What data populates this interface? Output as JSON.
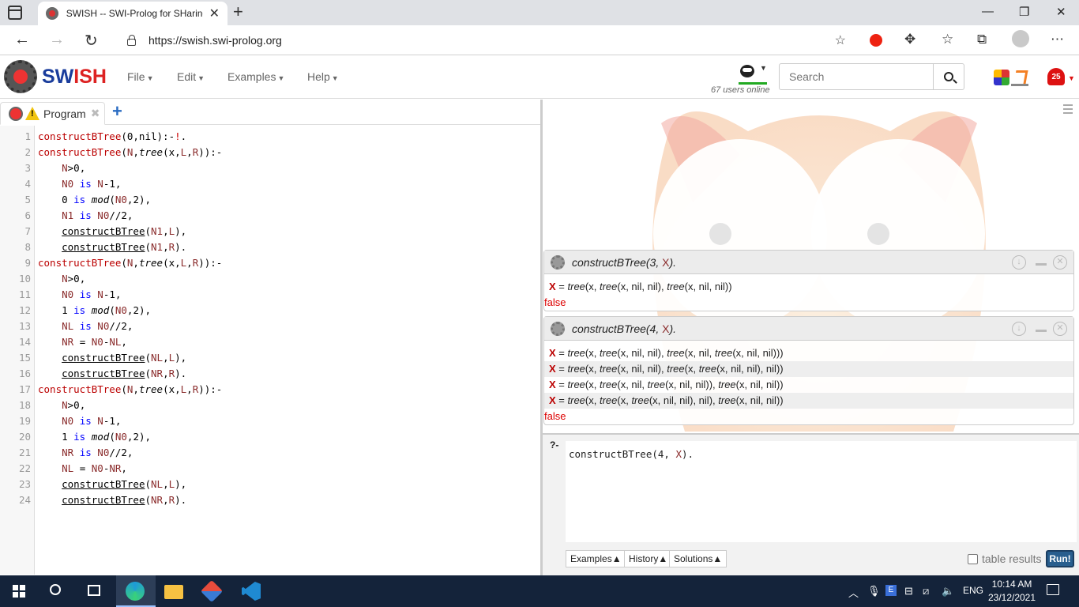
{
  "browser": {
    "tab_title": "SWISH -- SWI-Prolog for SHaring",
    "url": "https://swish.swi-prolog.org",
    "new_tab_icon": "plus-icon"
  },
  "swish": {
    "brand_sw": "SW",
    "brand_ish": "ISH",
    "menu": [
      {
        "label": "File"
      },
      {
        "label": "Edit"
      },
      {
        "label": "Examples"
      },
      {
        "label": "Help"
      }
    ],
    "users_online": "67 users online",
    "search_placeholder": "Search",
    "notification_count": "25"
  },
  "editor": {
    "tab_label": "Program",
    "lines": [
      {
        "n": "1"
      },
      {
        "n": "2"
      },
      {
        "n": "3"
      },
      {
        "n": "4"
      },
      {
        "n": "5"
      },
      {
        "n": "6"
      },
      {
        "n": "7"
      },
      {
        "n": "8"
      },
      {
        "n": "9"
      },
      {
        "n": "10"
      },
      {
        "n": "11"
      },
      {
        "n": "12"
      },
      {
        "n": "13"
      },
      {
        "n": "14"
      },
      {
        "n": "15"
      },
      {
        "n": "16"
      },
      {
        "n": "17"
      },
      {
        "n": "18"
      },
      {
        "n": "19"
      },
      {
        "n": "20"
      },
      {
        "n": "21"
      },
      {
        "n": "22"
      },
      {
        "n": "23"
      },
      {
        "n": "24"
      }
    ],
    "code": [
      "constructBTree(0,nil):-!.",
      "constructBTree(N,tree(x,L,R)):-",
      "    N>0,",
      "    N0 is N-1,",
      "    0 is mod(N0,2),",
      "    N1 is N0//2,",
      "    constructBTree(N1,L),",
      "    constructBTree(N1,R).",
      "constructBTree(N,tree(x,L,R)):-",
      "    N>0,",
      "    N0 is N-1,",
      "    1 is mod(N0,2),",
      "    NL is N0//2,",
      "    NR = N0-NL,",
      "    constructBTree(NL,L),",
      "    constructBTree(NR,R).",
      "constructBTree(N,tree(x,L,R)):-",
      "    N>0,",
      "    N0 is N-1,",
      "    1 is mod(N0,2),",
      "    NR is N0//2,",
      "    NL = N0-NR,",
      "    constructBTree(NL,L),",
      "    constructBTree(NR,R)."
    ]
  },
  "results": {
    "queries": [
      {
        "query": "constructBTree(3, X).",
        "answers": [
          "X = tree(x, tree(x, nil, nil), tree(x, nil, nil))"
        ],
        "end": "false"
      },
      {
        "query": "constructBTree(4, X).",
        "answers": [
          "X = tree(x, tree(x, nil, nil), tree(x, nil, tree(x, nil, nil)))",
          "X = tree(x, tree(x, nil, nil), tree(x, tree(x, nil, nil), nil))",
          "X = tree(x, tree(x, nil, tree(x, nil, nil)), tree(x, nil, nil))",
          "X = tree(x, tree(x, tree(x, nil, nil), nil), tree(x, nil, nil))"
        ],
        "end": "false"
      }
    ]
  },
  "query_editor": {
    "prompt": "?-",
    "text": "constructBTree(4, X).",
    "buttons": [
      "Examples",
      "History",
      "Solutions"
    ],
    "table_results_label": "table results",
    "run_label": "Run!"
  },
  "taskbar": {
    "language": "ENG",
    "time": "10:14 AM",
    "date": "23/12/2021"
  }
}
